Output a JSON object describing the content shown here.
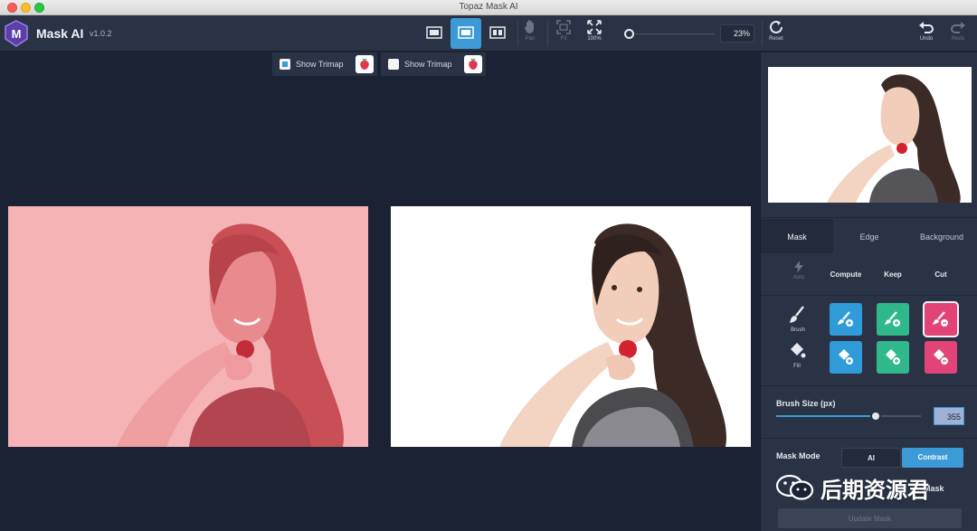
{
  "window": {
    "title": "Topaz Mask AI"
  },
  "app": {
    "name": "Mask AI",
    "version": "v1.0.2"
  },
  "toolbar": {
    "tools": [
      {
        "label": "Pan",
        "icon": "hand-icon"
      },
      {
        "label": "Fit",
        "icon": "fit-icon"
      },
      {
        "label": "100%",
        "icon": "actual-size-icon"
      }
    ],
    "zoom_value": "23%",
    "reset_label": "Reset",
    "undo_label": "Undo",
    "redo_label": "Redo"
  },
  "canvas": {
    "trimap_left": {
      "label": "Show Trimap",
      "checked": true
    },
    "trimap_right": {
      "label": "Show Trimap",
      "checked": false
    }
  },
  "panel": {
    "tabs": [
      {
        "label": "Mask",
        "active": true
      },
      {
        "label": "Edge",
        "active": false
      },
      {
        "label": "Background",
        "active": false
      }
    ],
    "actions": {
      "auto": "Auto",
      "compute": "Compute",
      "keep": "Keep",
      "cut": "Cut"
    },
    "brush_label": "Brush",
    "fill_label": "Fill",
    "brush_size_label": "Brush Size (px)",
    "brush_size_value": "355",
    "brush_size_fraction": 0.69,
    "mask_mode_label": "Mask Mode",
    "mask_modes": {
      "ai": "AI",
      "contrast": "Contrast"
    },
    "edit_mask_label": "Mask",
    "update_label": "Update Mask"
  },
  "watermark": {
    "text": "后期资源君"
  },
  "colors": {
    "accent": "#3c9ad6",
    "compute": "#2f9bd9",
    "keep": "#2fb88b",
    "cut": "#e24477"
  }
}
